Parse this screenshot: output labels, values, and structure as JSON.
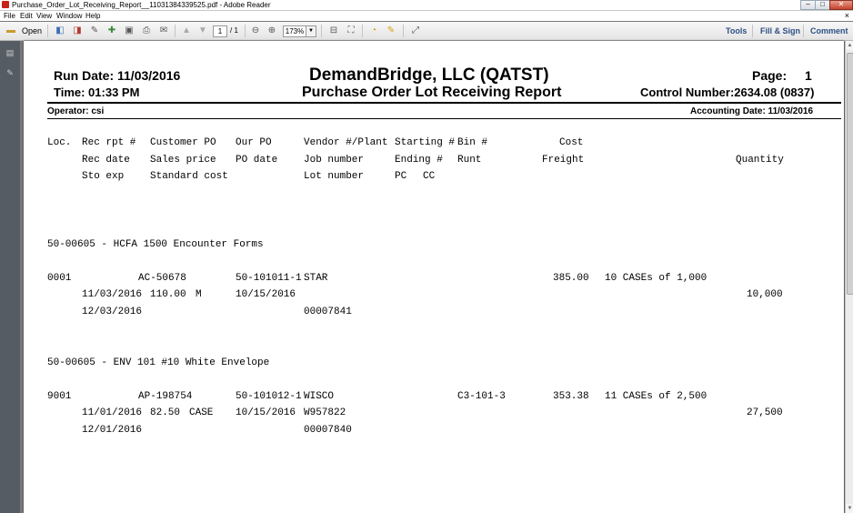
{
  "window": {
    "title": "Purchase_Order_Lot_Receiving_Report__11031384339525.pdf - Adobe Reader"
  },
  "menu": {
    "file": "File",
    "edit": "Edit",
    "view": "View",
    "window": "Window",
    "help": "Help"
  },
  "toolbar": {
    "open": "Open",
    "page_current": "1",
    "page_total": "/ 1",
    "zoom": "173%",
    "tools": "Tools",
    "fill_sign": "Fill & Sign",
    "comment": "Comment"
  },
  "report": {
    "run_date": "Run Date: 11/03/2016",
    "time": "Time: 01:33 PM",
    "company": "DemandBridge, LLC  (QATST)",
    "report_title": "Purchase Order Lot Receiving Report",
    "page_label": "Page:",
    "page_no": "1",
    "control": "Control Number:2634.08 (0837)",
    "operator": "Operator: csi",
    "accounting_date": "Accounting Date: 11/03/2016",
    "headers": {
      "loc": "Loc.",
      "rec_rpt": "Rec rpt #",
      "customer_po": "Customer PO",
      "our_po": "Our PO",
      "vendor_plant": "Vendor #/Plant",
      "starting": "Starting #",
      "bin": "Bin #",
      "cost": "Cost",
      "rec_date": "Rec date",
      "sales_price": "Sales price",
      "po_date": "PO date",
      "job_number": "Job number",
      "ending": "Ending #",
      "runt": "Runt",
      "freight": "Freight",
      "quantity": "Quantity",
      "sto_exp": "Sto exp",
      "standard_cost": "Standard cost",
      "lot_number": "Lot number",
      "pc": "PC",
      "cc": "CC"
    },
    "items": [
      {
        "heading": "50-00605 - HCFA 1500  Encounter Forms",
        "loc": "0001",
        "customer_po": "AC-50678",
        "our_po": "50-101011-1",
        "vendor": "STAR",
        "bin": "",
        "cost": "385.00",
        "units": "10 CASEs of 1,000",
        "rec_date": "11/03/2016",
        "sales_price": "110.00",
        "uom": "M",
        "po_date": "10/15/2016",
        "job_number": "",
        "quantity": "10,000",
        "sto_exp": "12/03/2016",
        "lot_number": "00007841"
      },
      {
        "heading": "50-00605 - ENV 101  #10 White Envelope",
        "loc": "9001",
        "customer_po": "AP-198754",
        "our_po": "50-101012-1",
        "vendor": "WISCO",
        "bin": "C3-101-3",
        "cost": "353.38",
        "units": "11 CASEs of 2,500",
        "rec_date": "11/01/2016",
        "sales_price": "82.50",
        "uom": "CASE",
        "po_date": "10/15/2016",
        "job_number": "W957822",
        "quantity": "27,500",
        "sto_exp": "12/01/2016",
        "lot_number": "00007840"
      }
    ]
  }
}
